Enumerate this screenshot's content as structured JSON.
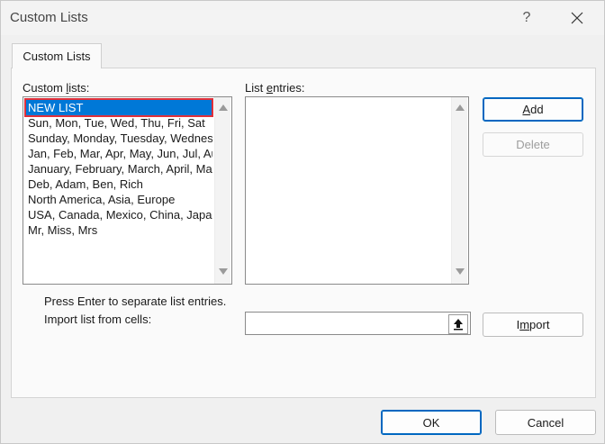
{
  "window": {
    "title": "Custom Lists",
    "help": "?"
  },
  "tabs": [
    {
      "label": "Custom Lists"
    }
  ],
  "custom_lists": {
    "label_pre": "Custom ",
    "label_ul": "l",
    "label_post": "ists:",
    "items": [
      "NEW LIST",
      "Sun, Mon, Tue, Wed, Thu, Fri, Sat",
      "Sunday, Monday, Tuesday, Wednes",
      "Jan, Feb, Mar, Apr, May, Jun, Jul, Au",
      "January, February, March, April, Ma",
      "Deb, Adam, Ben, Rich",
      "North America, Asia, Europe",
      "USA, Canada, Mexico, China, Japan,",
      "Mr, Miss, Mrs"
    ],
    "selected_index": 0
  },
  "list_entries": {
    "label_pre": "List ",
    "label_ul": "e",
    "label_post": "ntries:",
    "value": ""
  },
  "buttons": {
    "add": {
      "ul": "A",
      "rest": "dd"
    },
    "delete": {
      "label": "Delete"
    },
    "import": {
      "pre": "I",
      "ul": "m",
      "rest": "port"
    },
    "ok": {
      "label": "OK"
    },
    "cancel": {
      "label": "Cancel"
    }
  },
  "hint": "Press Enter to separate list entries.",
  "import": {
    "label_pre": "Import list from cells:",
    "value": ""
  },
  "colors": {
    "selection": "#0078d7",
    "highlight_border": "#e0303a",
    "primary_border": "#0067c0"
  }
}
